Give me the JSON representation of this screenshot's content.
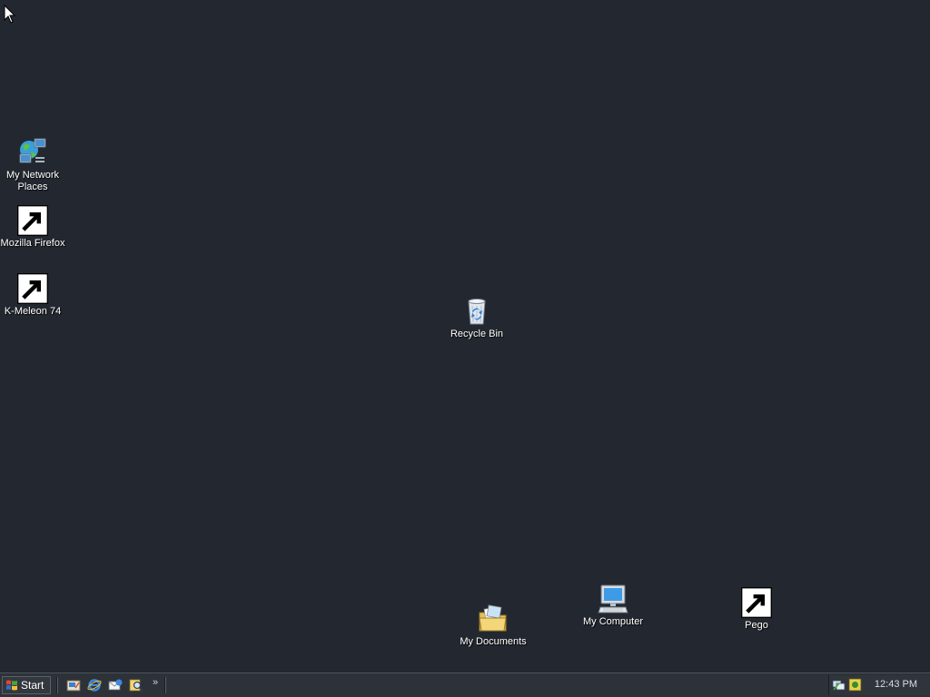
{
  "desktop": {
    "icons": {
      "network": {
        "label": "My Network\nPlaces",
        "icon": "network-places-icon"
      },
      "firefox": {
        "label": "Mozilla Firefox",
        "icon": "firefox-icon",
        "shortcut": true
      },
      "kmeleon": {
        "label": "K-Meleon 74",
        "icon": "k-meleon-icon",
        "shortcut": true
      },
      "recycle": {
        "label": "Recycle Bin",
        "icon": "recycle-bin-icon"
      },
      "documents": {
        "label": "My Documents",
        "icon": "my-documents-icon"
      },
      "computer": {
        "label": "My Computer",
        "icon": "my-computer-icon"
      },
      "pego": {
        "label": "Pego",
        "icon": "pego-icon",
        "shortcut": true
      }
    }
  },
  "taskbar": {
    "start_label": "Start",
    "quick_launch": [
      "show-desktop-icon",
      "internet-explorer-icon",
      "outlook-express-icon",
      "search-icon"
    ],
    "overflow_label": "»",
    "tray_icons": [
      "network-tray-icon",
      "security-tray-icon"
    ],
    "clock": "12:43 PM"
  },
  "colors": {
    "desktop_background": "#232830",
    "taskbar_background": "#2d3239",
    "label_text": "#ffffff"
  }
}
